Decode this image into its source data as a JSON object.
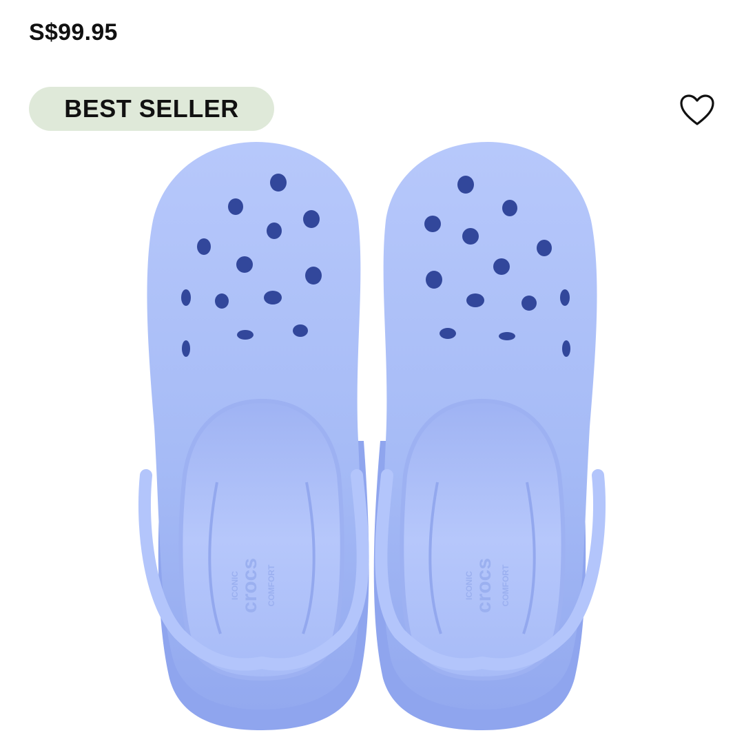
{
  "product": {
    "price": "S$99.95",
    "badge": "BEST SELLER",
    "image_alt": "Light blue clog pair, top view",
    "insole_text": {
      "brand": "crocs",
      "line1": "ICONIC",
      "line2": "COMFORT"
    }
  },
  "colors": {
    "badge_bg": "#dfe9d9",
    "shoe": "#a9bdf7",
    "shoe_shadow": "#8ea5ee",
    "hole": "#32479b",
    "heart": "#111111"
  },
  "icons": {
    "wishlist": "heart-outline-icon"
  }
}
